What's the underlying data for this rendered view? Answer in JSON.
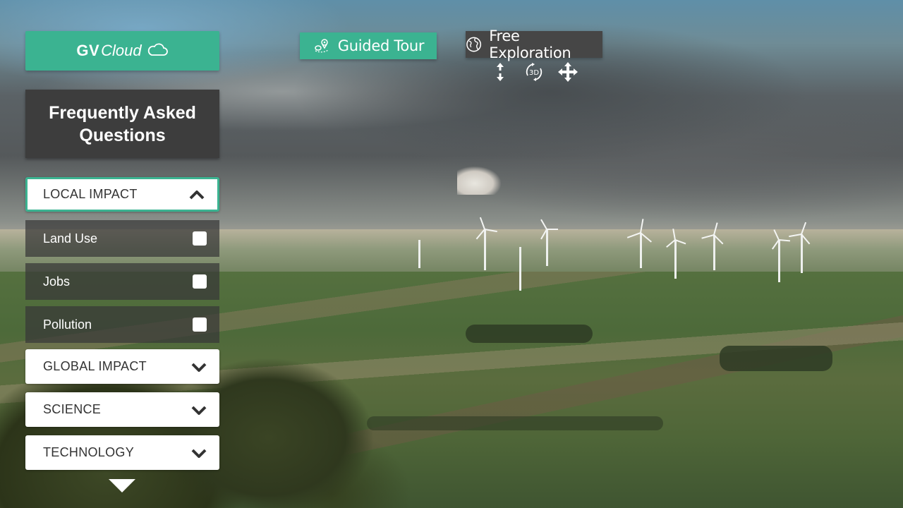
{
  "brand": {
    "name_bold": "GV",
    "name_italic": "Cloud",
    "icon": "cloud-outline-icon",
    "accent_color": "#3bb391"
  },
  "top_nav": {
    "guided_tour": {
      "label": "Guided Tour",
      "icon": "map-pin-route-icon",
      "color": "#3bb391"
    },
    "free_exploration": {
      "label": "Free Exploration",
      "icon": "globe-icon",
      "color": "#464646"
    },
    "view_controls": [
      {
        "name": "vertical-move-icon"
      },
      {
        "name": "rotate-3d-icon",
        "label": "3D"
      },
      {
        "name": "move-arrows-icon"
      }
    ]
  },
  "faq": {
    "title": "Frequently Asked Questions",
    "sections": [
      {
        "label": "LOCAL IMPACT",
        "expanded": true,
        "items": [
          {
            "label": "Land Use",
            "checked": false
          },
          {
            "label": "Jobs",
            "checked": false
          },
          {
            "label": "Pollution",
            "checked": false
          }
        ]
      },
      {
        "label": "GLOBAL IMPACT",
        "expanded": false
      },
      {
        "label": "SCIENCE",
        "expanded": false
      },
      {
        "label": "TECHNOLOGY",
        "expanded": false
      }
    ],
    "scroll_more_icon": "triangle-down-icon"
  }
}
